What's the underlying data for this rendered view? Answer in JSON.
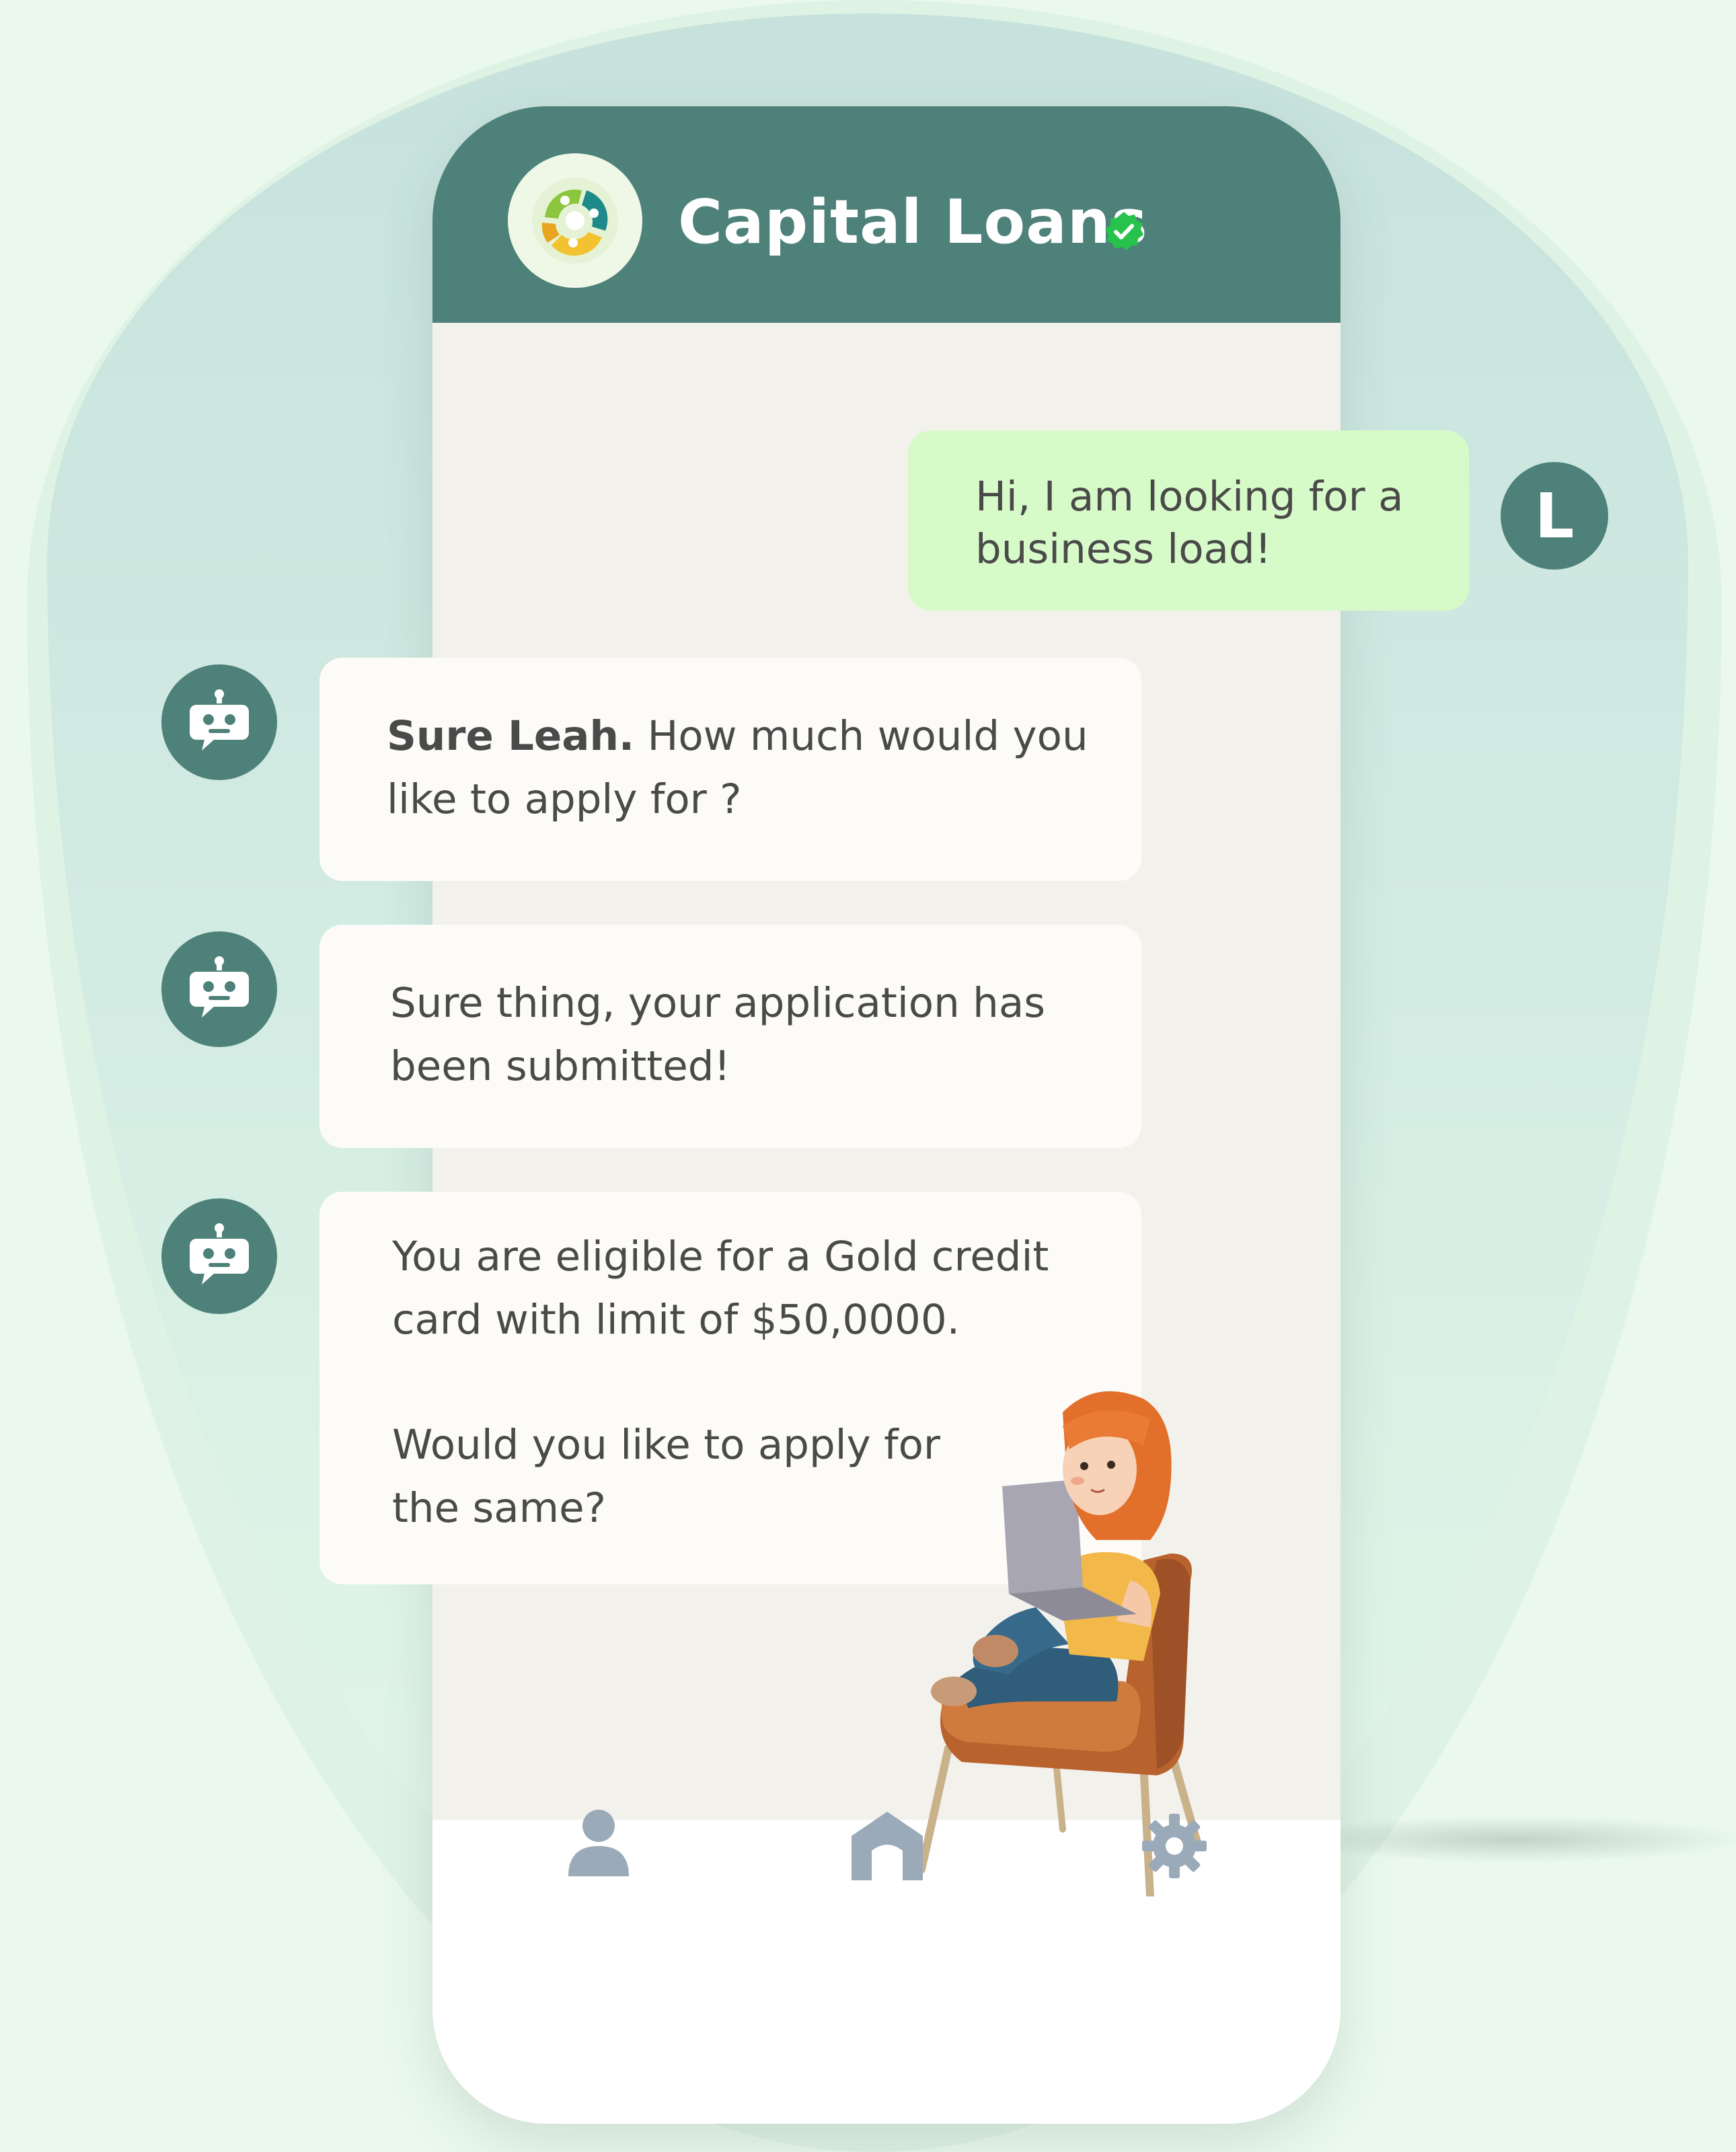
{
  "header": {
    "brand_name": "Capital Loans",
    "verified_badge": "verified-check-icon",
    "logo": "capital-loans-logo"
  },
  "user": {
    "avatar_initial": "L",
    "message": "Hi, I am looking for a business load!"
  },
  "bot_messages": [
    {
      "bold": "Sure Leah.",
      "text": " How much would you like to apply for ?"
    },
    {
      "text": "Sure thing, your application has been submitted!"
    },
    {
      "text_p1": "You are eligible for a Gold credit card with limit of $50,0000.",
      "text_p2": "Would you like to apply for the same?"
    }
  ],
  "bot_avatar_icon": "robot-icon",
  "nav": {
    "items": [
      {
        "icon": "user-icon"
      },
      {
        "icon": "home-icon"
      },
      {
        "icon": "gear-icon"
      }
    ]
  },
  "colors": {
    "primary": "#4e8179",
    "user_bubble": "#d7fbc8",
    "bot_bubble": "#fcfbf8",
    "chat_bg": "#f3f1ec",
    "nav_icon": "#9aaab8",
    "verified": "#27c24c"
  }
}
